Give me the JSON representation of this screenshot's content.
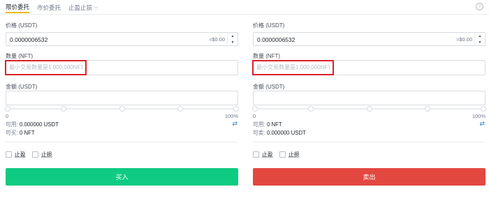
{
  "tabs": [
    {
      "label": "限价委托"
    },
    {
      "label": "市价委托"
    },
    {
      "label": "止盈止损"
    }
  ],
  "buy": {
    "price_label": "价格 (USDT)",
    "price_value": "0.0000006532",
    "price_approx": "≈$0.00",
    "qty_label": "数量 (NFT)",
    "qty_placeholder": "最小交易数量是1,000,000NFT",
    "amount_label": "金额 (USDT)",
    "slider_min": "0",
    "slider_max": "100%",
    "avail_label": "可用:",
    "avail_value": "0.000000 USDT",
    "max_label": "可买:",
    "max_value": "0 NFT",
    "tp_label": "止盈",
    "sl_label": "止损",
    "button_label": "买入"
  },
  "sell": {
    "price_label": "价格 (USDT)",
    "price_value": "0.0000006532",
    "price_approx": "≈$0.00",
    "qty_label": "数量 (NFT)",
    "qty_placeholder": "最小交易数量是1,000,000NFT",
    "amount_label": "金额 (USDT)",
    "slider_min": "0",
    "slider_max": "100%",
    "avail_label": "可用:",
    "avail_value": "0 NFT",
    "max_label": "可卖:",
    "max_value": "0.000000 USDT",
    "tp_label": "止盈",
    "sl_label": "止损",
    "button_label": "卖出"
  },
  "colors": {
    "buy": "#0ecb81",
    "sell": "#e24840",
    "highlight_box": "#d9212c",
    "active_tab_underline": "#f0b90b"
  },
  "icons": {
    "help": "question-circle-icon",
    "dropdown": "chevron-down-icon",
    "swap": "swap-icon"
  }
}
